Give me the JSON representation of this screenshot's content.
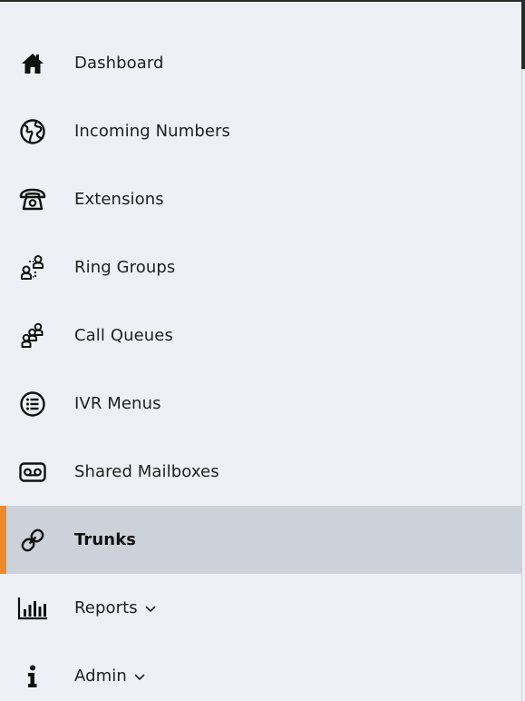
{
  "nav": {
    "items": [
      {
        "label": "Dashboard",
        "icon": "home-icon"
      },
      {
        "label": "Incoming Numbers",
        "icon": "globe-icon"
      },
      {
        "label": "Extensions",
        "icon": "telephone-icon"
      },
      {
        "label": "Ring Groups",
        "icon": "ring-groups-icon"
      },
      {
        "label": "Call Queues",
        "icon": "call-queues-icon"
      },
      {
        "label": "IVR Menus",
        "icon": "list-circle-icon"
      },
      {
        "label": "Shared Mailboxes",
        "icon": "voicemail-icon"
      },
      {
        "label": "Trunks",
        "icon": "link-icon",
        "active": true
      },
      {
        "label": "Reports",
        "icon": "bar-chart-icon",
        "has_submenu": true
      },
      {
        "label": "Admin",
        "icon": "info-icon",
        "has_submenu": true
      }
    ]
  },
  "colors": {
    "background": "#eff0f5",
    "active_background": "#cdd1da",
    "active_accent": "#f08a24",
    "text": "#1e1e1e"
  }
}
